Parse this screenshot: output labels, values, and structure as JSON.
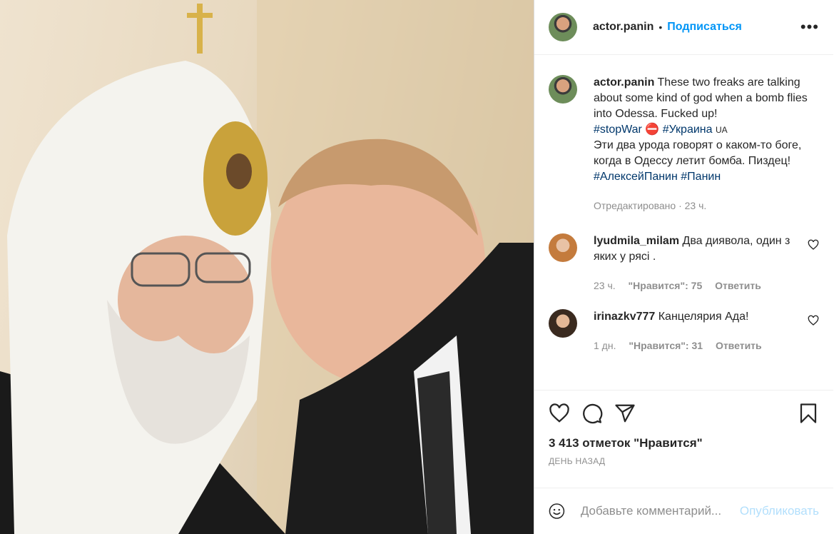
{
  "post": {
    "username": "actor.panin",
    "follow_label": "Подписаться",
    "more_label": "•••",
    "caption_en": "These two freaks are talking about some kind of god when a bomb flies into Odessa. Fucked up!",
    "tag_stopwar": "#stopWar",
    "stop_emoji": "⛔",
    "tag_ukraine": "#Украина",
    "flag_ua": "UA",
    "caption_ru": "Эти два урода говорят о каком-то боге, когда в Одессу летит бомба. Пиздец!",
    "tag_panin_full": "#АлексейПанин",
    "tag_panin": "#Панин",
    "edited_meta": "Отредактировано · 23 ч."
  },
  "comments": [
    {
      "username": "lyudmila_milam",
      "text": "Два диявола, один з яких у рясі .",
      "time": "23 ч.",
      "likes": "\"Нравится\": 75",
      "reply": "Ответить"
    },
    {
      "username": "irinazkv777",
      "text": "Канцелярия Ада!",
      "time": "1 дн.",
      "likes": "\"Нравится\": 31",
      "reply": "Ответить"
    }
  ],
  "icons": [
    "heart-icon",
    "comment-icon",
    "share-icon",
    "bookmark-icon",
    "emoji-icon",
    "more-icon"
  ],
  "likes_count": "3 413 отметок \"Нравится\"",
  "date_label": "ДЕНЬ НАЗАД",
  "composer": {
    "placeholder": "Добавьте комментарий...",
    "publish": "Опубликовать"
  },
  "colors": {
    "accent": "#0095f6",
    "tag": "#00376b",
    "muted": "#8e8e8e",
    "publish_disabled": "#b2dffc"
  }
}
